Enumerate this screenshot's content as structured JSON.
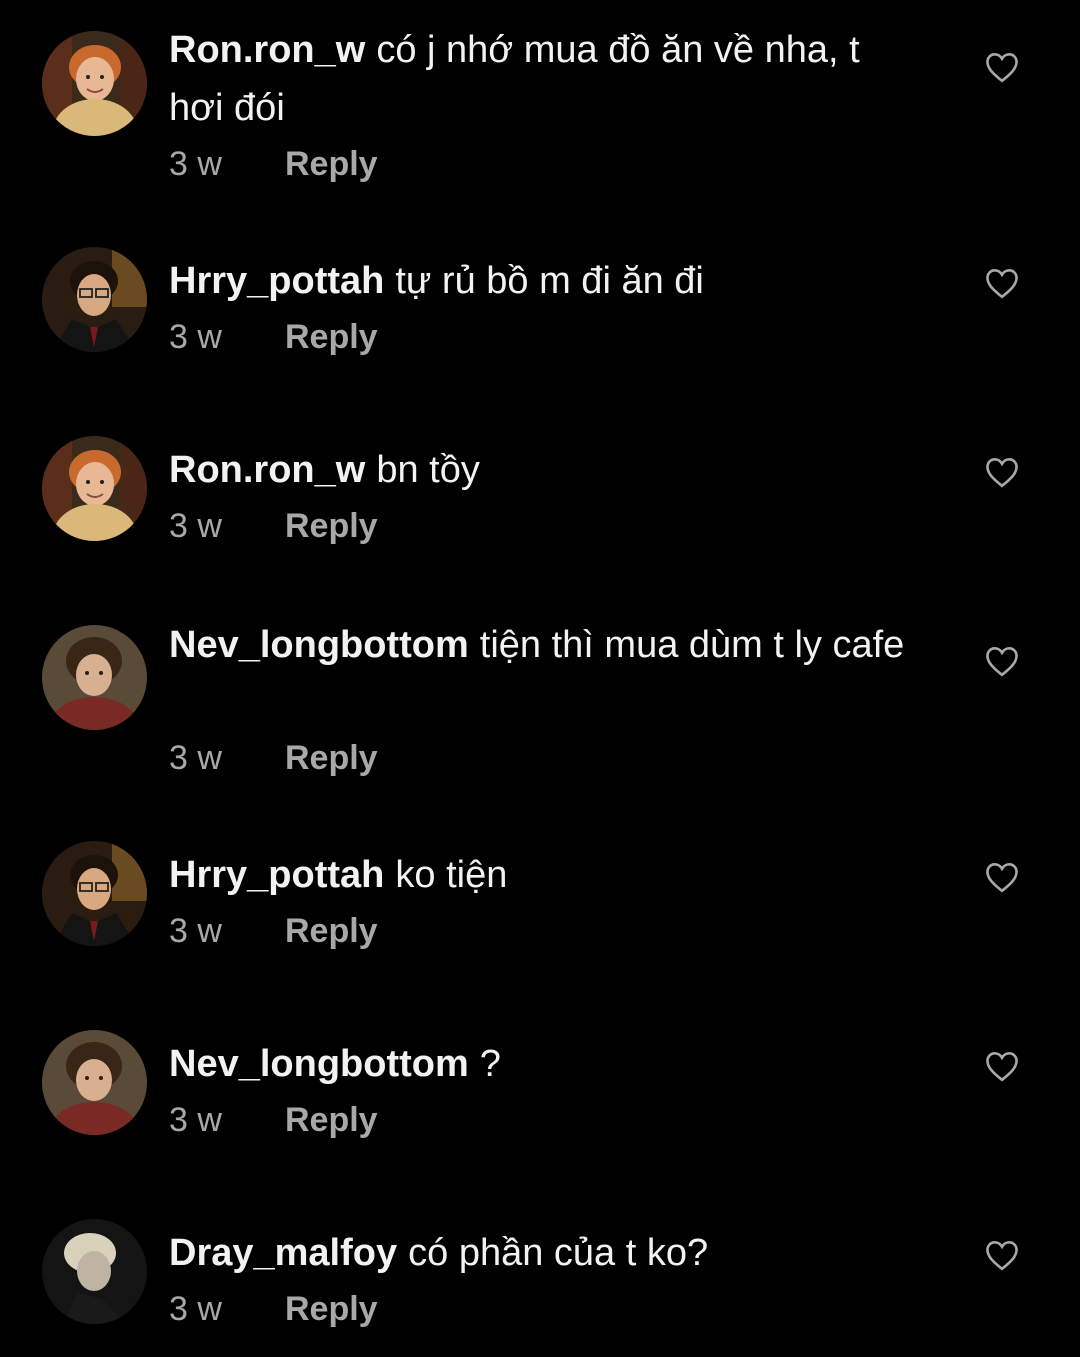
{
  "comments": [
    {
      "avatar": "ron-avatar",
      "username": "Ron.ron_w",
      "text": "có j nhớ mua đồ ăn về nha, t hơi đói",
      "time": "3 w",
      "reply": "Reply"
    },
    {
      "avatar": "harry-avatar",
      "username": "Hrry_pottah",
      "text": "tự rủ bồ m đi ăn đi",
      "time": "3 w",
      "reply": "Reply"
    },
    {
      "avatar": "ron-avatar",
      "username": "Ron.ron_w",
      "text": "bn tồy",
      "time": "3 w",
      "reply": "Reply"
    },
    {
      "avatar": "neville-avatar",
      "username": "Nev_longbottom",
      "text": "tiện thì mua dùm t ly cafe",
      "time": "3 w",
      "reply": "Reply"
    },
    {
      "avatar": "harry-avatar",
      "username": "Hrry_pottah",
      "text": "ko tiện",
      "time": "3 w",
      "reply": "Reply"
    },
    {
      "avatar": "neville-avatar",
      "username": "Nev_longbottom",
      "text": "?",
      "time": "3 w",
      "reply": "Reply"
    },
    {
      "avatar": "draco-avatar",
      "username": "Dray_malfoy",
      "text": "có phần của t ko?",
      "time": "3 w",
      "reply": "Reply"
    }
  ],
  "icons": {
    "like": "heart-outline-icon"
  },
  "colors": {
    "background": "#000000",
    "text": "#f2f2f2",
    "meta": "#a8a8a8"
  }
}
